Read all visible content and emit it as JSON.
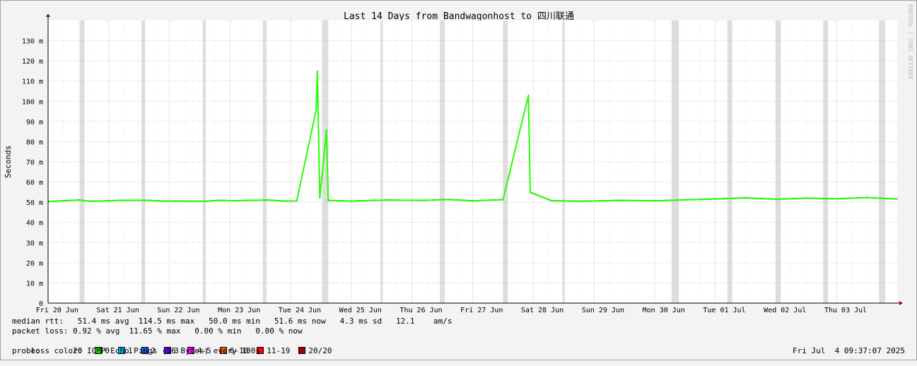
{
  "chart_data": {
    "type": "line",
    "title": "Last 14 Days from Bandwagonhost to 四川联通",
    "ylabel": "Seconds",
    "watermark": "RRDTOOL / TOBI OETIKER",
    "ylim": [
      0,
      140
    ],
    "y_ticks": [
      {
        "v": 0,
        "label": "0"
      },
      {
        "v": 10,
        "label": "10 m"
      },
      {
        "v": 20,
        "label": "20 m"
      },
      {
        "v": 30,
        "label": "30 m"
      },
      {
        "v": 40,
        "label": "40 m"
      },
      {
        "v": 50,
        "label": "50 m"
      },
      {
        "v": 60,
        "label": "60 m"
      },
      {
        "v": 70,
        "label": "70 m"
      },
      {
        "v": 80,
        "label": "80 m"
      },
      {
        "v": 90,
        "label": "90 m"
      },
      {
        "v": 100,
        "label": "100 m"
      },
      {
        "v": 110,
        "label": "110 m"
      },
      {
        "v": 120,
        "label": "120 m"
      },
      {
        "v": 130,
        "label": "130 m"
      }
    ],
    "xlim_days": [
      0,
      14
    ],
    "x_ticks": [
      {
        "d": 0,
        "label": "Fri 20 Jun"
      },
      {
        "d": 1,
        "label": "Sat 21 Jun"
      },
      {
        "d": 2,
        "label": "Sun 22 Jun"
      },
      {
        "d": 3,
        "label": "Mon 23 Jun"
      },
      {
        "d": 4,
        "label": "Tue 24 Jun"
      },
      {
        "d": 5,
        "label": "Wed 25 Jun"
      },
      {
        "d": 6,
        "label": "Thu 26 Jun"
      },
      {
        "d": 7,
        "label": "Fri 27 Jun"
      },
      {
        "d": 8,
        "label": "Sat 28 Jun"
      },
      {
        "d": 9,
        "label": "Sun 29 Jun"
      },
      {
        "d": 10,
        "label": "Mon 30 Jun"
      },
      {
        "d": 11,
        "label": "Tue 01 Jul"
      },
      {
        "d": 12,
        "label": "Wed 02 Jul"
      },
      {
        "d": 13,
        "label": "Thu 03 Jul"
      }
    ],
    "median_series": [
      [
        0.0,
        50.5
      ],
      [
        0.5,
        51.2
      ],
      [
        0.7,
        50.6
      ],
      [
        1.2,
        51.0
      ],
      [
        1.6,
        51.1
      ],
      [
        1.9,
        50.7
      ],
      [
        2.6,
        50.6
      ],
      [
        2.8,
        51.0
      ],
      [
        3.1,
        50.9
      ],
      [
        3.6,
        51.2
      ],
      [
        3.9,
        50.7
      ],
      [
        4.1,
        50.8
      ],
      [
        4.42,
        96.0
      ],
      [
        4.44,
        115.0
      ],
      [
        4.48,
        52.0
      ],
      [
        4.59,
        86.0
      ],
      [
        4.62,
        51.0
      ],
      [
        5.0,
        50.7
      ],
      [
        5.6,
        51.2
      ],
      [
        6.2,
        51.0
      ],
      [
        6.6,
        51.5
      ],
      [
        7.0,
        50.8
      ],
      [
        7.5,
        51.4
      ],
      [
        7.92,
        103.0
      ],
      [
        7.95,
        55.0
      ],
      [
        8.3,
        50.9
      ],
      [
        8.8,
        50.6
      ],
      [
        9.4,
        51.0
      ],
      [
        10.1,
        50.9
      ],
      [
        10.6,
        51.4
      ],
      [
        11.0,
        51.7
      ],
      [
        11.5,
        52.3
      ],
      [
        12.0,
        51.6
      ],
      [
        12.5,
        52.1
      ],
      [
        13.0,
        51.8
      ],
      [
        13.5,
        52.4
      ],
      [
        14.0,
        51.7
      ]
    ],
    "loss_gaps_days": [
      [
        0.52,
        0.6
      ],
      [
        1.54,
        1.6
      ],
      [
        2.55,
        2.6
      ],
      [
        3.54,
        3.6
      ],
      [
        4.52,
        4.62
      ],
      [
        5.48,
        5.52
      ],
      [
        6.46,
        6.54
      ],
      [
        7.5,
        7.58
      ],
      [
        8.48,
        8.52
      ],
      [
        10.28,
        10.4
      ],
      [
        11.2,
        11.28
      ],
      [
        12.0,
        12.08
      ],
      [
        12.78,
        12.86
      ],
      [
        13.7,
        13.8
      ]
    ],
    "loss_colors": {
      "0": "#26ff00",
      "1": "#00b8ff",
      "2": "#0059ff",
      "3": "#5e00ff",
      "4-5": "#ff00fe",
      "6-10": "#ff5500",
      "11-19": "#ff0000",
      "20/20": "#a10000"
    }
  },
  "stats": {
    "median_rtt": "median rtt:   51.4 ms avg  114.5 ms max   50.0 ms min   51.6 ms now   4.3 ms sd   12.1    am/s",
    "packet_loss": "packet loss: 0.92 % avg  11.65 % max   0.00 % min   0.00 % now",
    "loss_color_label": "loss color:",
    "loss_items": [
      {
        "label": "0",
        "color": "#26ff00"
      },
      {
        "label": "1",
        "color": "#00b8ff"
      },
      {
        "label": "2",
        "color": "#0059ff"
      },
      {
        "label": "3",
        "color": "#5e00ff"
      },
      {
        "label": "4-5",
        "color": "#ff00fe"
      },
      {
        "label": "6-10",
        "color": "#ff5500"
      },
      {
        "label": "11-19",
        "color": "#ff0000"
      },
      {
        "label": "20/20",
        "color": "#a10000"
      }
    ],
    "probe": "probe:       20 ICMP Echo Pings (56 Bytes) every 180s",
    "timestamp": "Fri Jul  4 09:37:07 2025"
  }
}
